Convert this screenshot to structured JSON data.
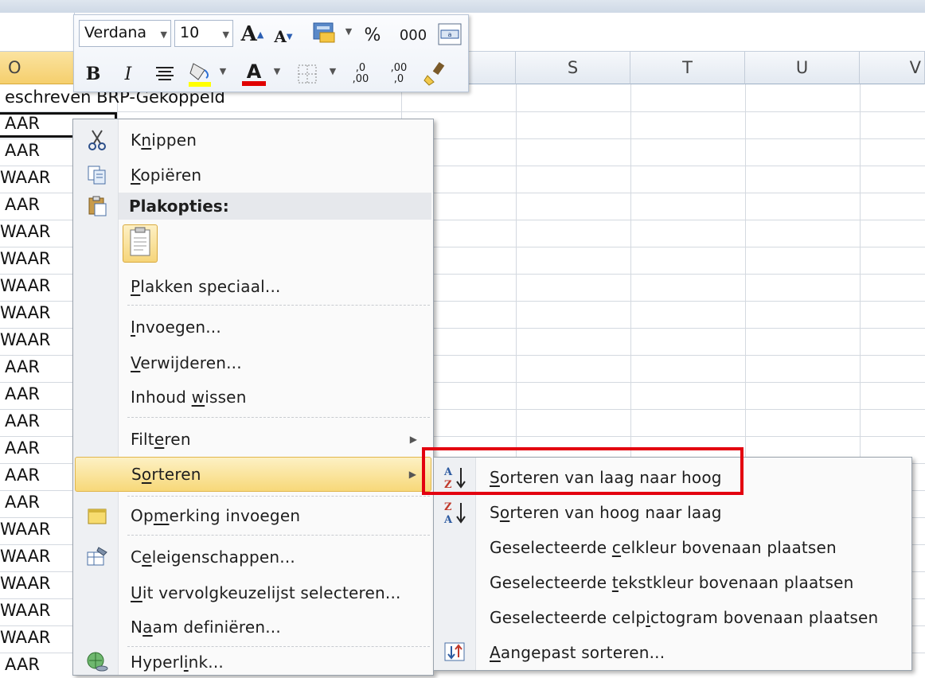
{
  "columns": [
    {
      "name": "O",
      "selected": true
    },
    {
      "name": "S"
    },
    {
      "name": "T"
    },
    {
      "name": "U"
    },
    {
      "name": "V"
    }
  ],
  "header_row_text": "eschreven BRP-Gekoppeld",
  "cells": [
    "AAR",
    "AAR",
    "WAAR",
    "AAR",
    "WAAR",
    "WAAR",
    "WAAR",
    "WAAR",
    "WAAR",
    "AAR",
    "AAR",
    "AAR",
    "AAR",
    "AAR",
    "AAR",
    "WAAR",
    "WAAR",
    "WAAR",
    "WAAR",
    "WAAR",
    "AAR"
  ],
  "mini_toolbar": {
    "font_name": "Verdana",
    "font_size": "10",
    "percent": "%",
    "thousands": "000",
    "bold": "B",
    "italic": "I",
    "font_color_letter": "A",
    "grow_font": "A",
    "shrink_font": "A",
    "inc_decimals": {
      "top": ",0",
      "bottom": ",00"
    },
    "dec_decimals": {
      "top": ",00",
      "bottom": ",0"
    }
  },
  "context_menu": {
    "cut": {
      "pre": "K",
      "accel": "n",
      "post": "ippen"
    },
    "copy": {
      "pre": "",
      "accel": "K",
      "post": "opiëren"
    },
    "paste_options_header": "Plakopties:",
    "paste_special": {
      "pre": "",
      "accel": "P",
      "post": "lakken speciaal..."
    },
    "insert": {
      "pre": "",
      "accel": "I",
      "post": "nvoegen..."
    },
    "delete": {
      "pre": "",
      "accel": "V",
      "post": "erwijderen..."
    },
    "clear_contents": {
      "pre": "Inhoud ",
      "accel": "w",
      "post": "issen"
    },
    "filter": {
      "pre": "Filt",
      "accel": "e",
      "post": "ren"
    },
    "sort": {
      "pre": "S",
      "accel": "o",
      "post": "rteren"
    },
    "insert_comment": {
      "pre": "Op",
      "accel": "m",
      "post": "erking invoegen"
    },
    "format_cells": {
      "pre": "C",
      "accel": "e",
      "post": "leigenschappen..."
    },
    "pick_from_list": {
      "pre": "",
      "accel": "U",
      "post": "it vervolgkeuzelijst selecteren..."
    },
    "define_name": {
      "pre": "N",
      "accel": "a",
      "post": "am definiëren..."
    },
    "hyperlink": {
      "pre": "Hyperl",
      "accel": "i",
      "post": "nk..."
    }
  },
  "sort_submenu": {
    "asc": {
      "pre": "",
      "accel": "S",
      "post": "orteren van laag naar hoog"
    },
    "desc": {
      "pre": "S",
      "accel": "o",
      "post": "rteren van hoog naar laag"
    },
    "cell_color": {
      "pre": "Geselecteerde ",
      "accel": "c",
      "post": "elkleur bovenaan plaatsen"
    },
    "font_color": {
      "pre": "Geselecteerde ",
      "accel": "t",
      "post": "ekstkleur bovenaan plaatsen"
    },
    "cell_icon": {
      "pre": "Geselecteerde celp",
      "accel": "i",
      "post": "ctogram bovenaan plaatsen"
    },
    "custom": {
      "pre": "",
      "accel": "A",
      "post": "angepast sorteren..."
    }
  },
  "icon_letters": {
    "a": "A",
    "z": "Z"
  },
  "colors": {
    "highlight_box": "#e3000f",
    "menu_hover": "#f7d879",
    "selected_column": "#f5cf6d"
  }
}
